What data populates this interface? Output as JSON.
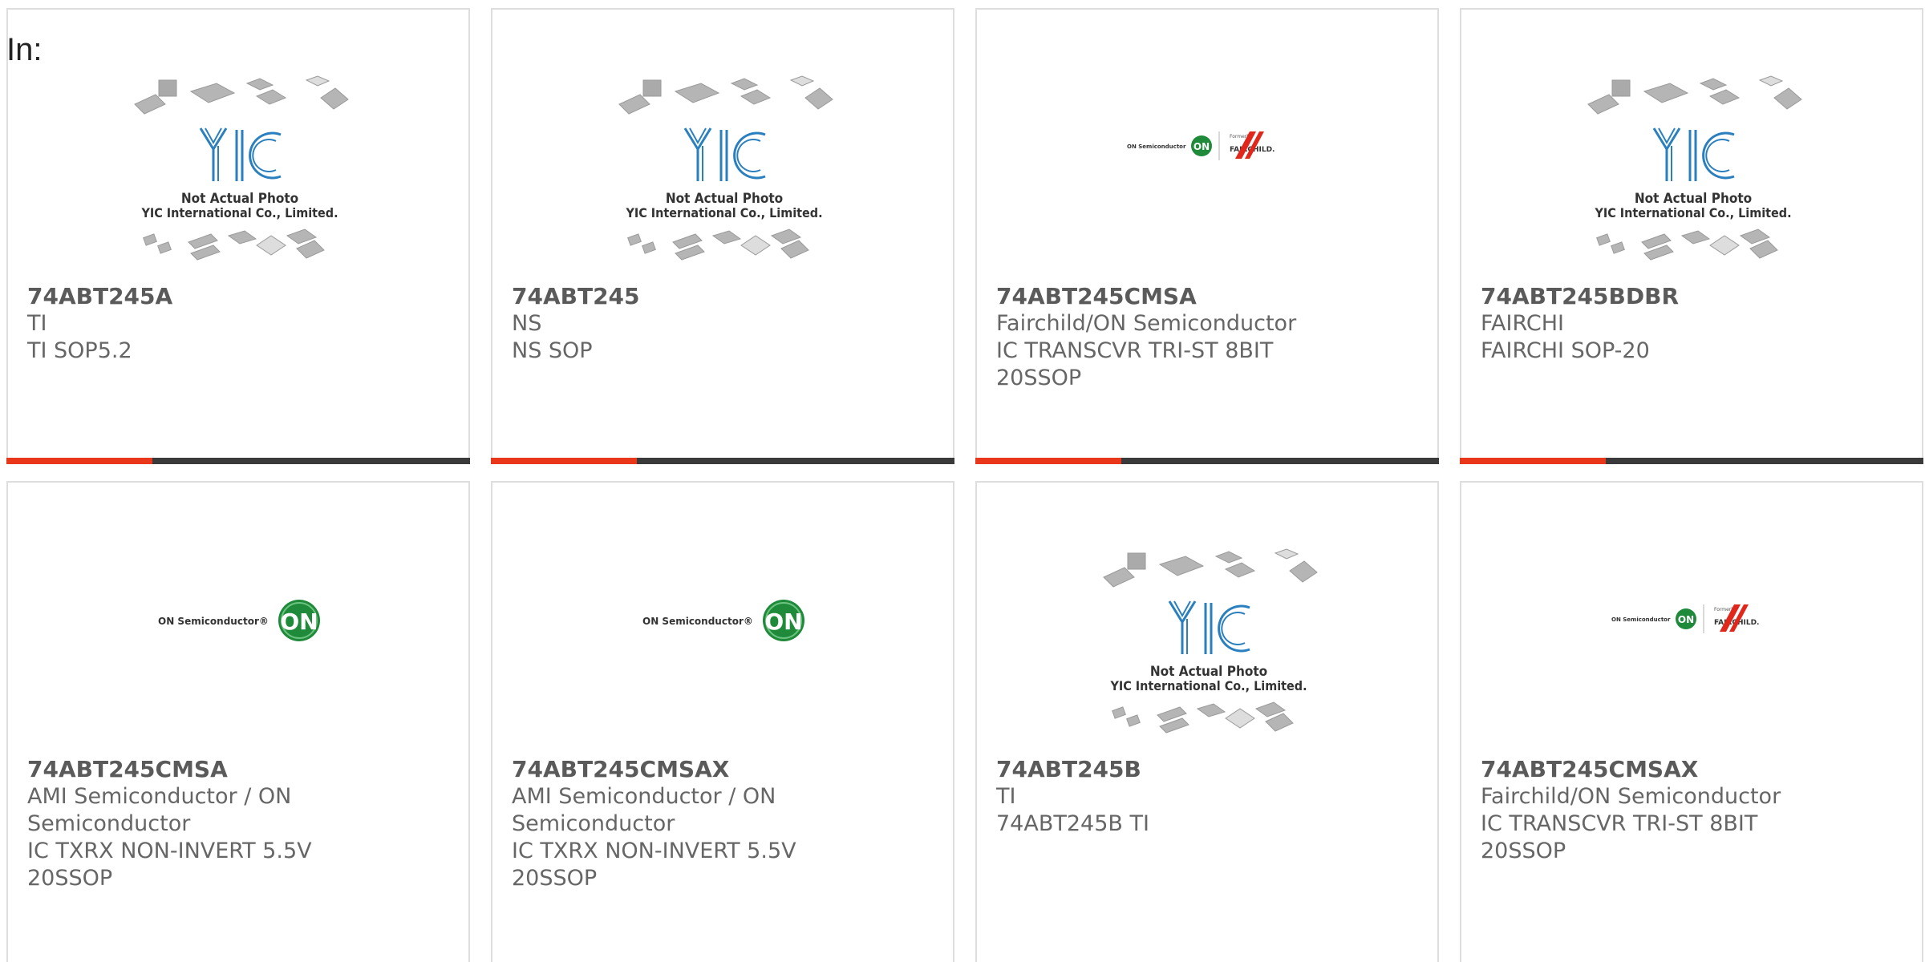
{
  "filter_label": "In:",
  "placeholder_text": {
    "line1": "Not Actual Photo",
    "line2": "YIC International Co., Limited.",
    "logo": "YIC"
  },
  "logos": {
    "on_semi": "ON Semiconductor",
    "on": "ON",
    "formerly": "Formerly",
    "fairchild": "FAIRCHILD."
  },
  "colors": {
    "accent": "#e8371b",
    "bar": "#3a3a3a",
    "on_green": "#1f8a3a",
    "yic_blue": "#2a7fbf"
  },
  "products": [
    {
      "part": "74ABT245A",
      "lines": [
        "TI",
        "TI SOP5.2"
      ],
      "image": "yic-placeholder"
    },
    {
      "part": "74ABT245",
      "lines": [
        "NS",
        "NS SOP"
      ],
      "image": "yic-placeholder"
    },
    {
      "part": "74ABT245CMSA",
      "lines": [
        "Fairchild/ON Semiconductor",
        "IC TRANSCVR TRI-ST 8BIT",
        "20SSOP"
      ],
      "image": "on-fairchild-logo"
    },
    {
      "part": "74ABT245BDBR",
      "lines": [
        "FAIRCHI",
        "FAIRCHI SOP-20"
      ],
      "image": "yic-placeholder"
    },
    {
      "part": "74ABT245CMSA",
      "lines": [
        "AMI Semiconductor / ON",
        "Semiconductor",
        "IC TXRX NON-INVERT 5.5V",
        "20SSOP"
      ],
      "image": "on-semi-logo"
    },
    {
      "part": "74ABT245CMSAX",
      "lines": [
        "AMI Semiconductor / ON",
        "Semiconductor",
        "IC TXRX NON-INVERT 5.5V",
        "20SSOP"
      ],
      "image": "on-semi-logo"
    },
    {
      "part": "74ABT245B",
      "lines": [
        "TI",
        "74ABT245B TI"
      ],
      "image": "yic-placeholder"
    },
    {
      "part": "74ABT245CMSAX",
      "lines": [
        "Fairchild/ON Semiconductor",
        "IC TRANSCVR TRI-ST 8BIT",
        "20SSOP"
      ],
      "image": "on-fairchild-logo"
    }
  ]
}
